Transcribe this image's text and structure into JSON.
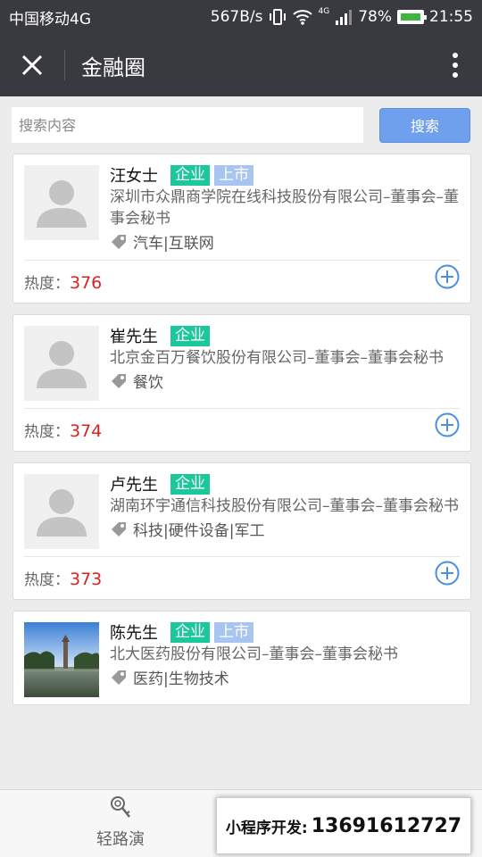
{
  "status_bar": {
    "carrier": "中国移动4G",
    "speed": "567B/s",
    "network_badge": "4G",
    "battery": "78%",
    "time": "21:55"
  },
  "nav": {
    "title": "金融圈"
  },
  "search": {
    "placeholder": "搜索内容",
    "button_label": "搜索"
  },
  "list": {
    "heat_label": "热度：",
    "items": [
      {
        "name": "汪女士",
        "tags": [
          "企业",
          "上市"
        ],
        "company": "深圳市众鼎商学院在线科技股份有限公司–董事会–董事会秘书",
        "industry": "汽车|互联网",
        "heat": "376",
        "avatar": "placeholder"
      },
      {
        "name": "崔先生",
        "tags": [
          "企业"
        ],
        "company": "北京金百万餐饮股份有限公司–董事会–董事会秘书",
        "industry": "餐饮",
        "heat": "374",
        "avatar": "placeholder"
      },
      {
        "name": "卢先生",
        "tags": [
          "企业"
        ],
        "company": "湖南环宇通信科技股份有限公司–董事会–董事会秘书",
        "industry": "科技|硬件设备|军工",
        "heat": "373",
        "avatar": "placeholder"
      },
      {
        "name": "陈先生",
        "tags": [
          "企业",
          "上市"
        ],
        "company": "北大医药股份有限公司–董事会–董事会秘书",
        "industry": "医药|生物技术",
        "heat": "",
        "avatar": "photo"
      }
    ]
  },
  "bottom": {
    "tab_label": "轻路演",
    "promo_label": "小程序开发:",
    "promo_phone": "13691612727"
  },
  "colors": {
    "header_bg": "#393a3f",
    "tag_enterprise": "#1cc79c",
    "tag_listed": "#a8c4f0",
    "heat_value": "#e02020",
    "search_button": "#6ea0ee"
  }
}
